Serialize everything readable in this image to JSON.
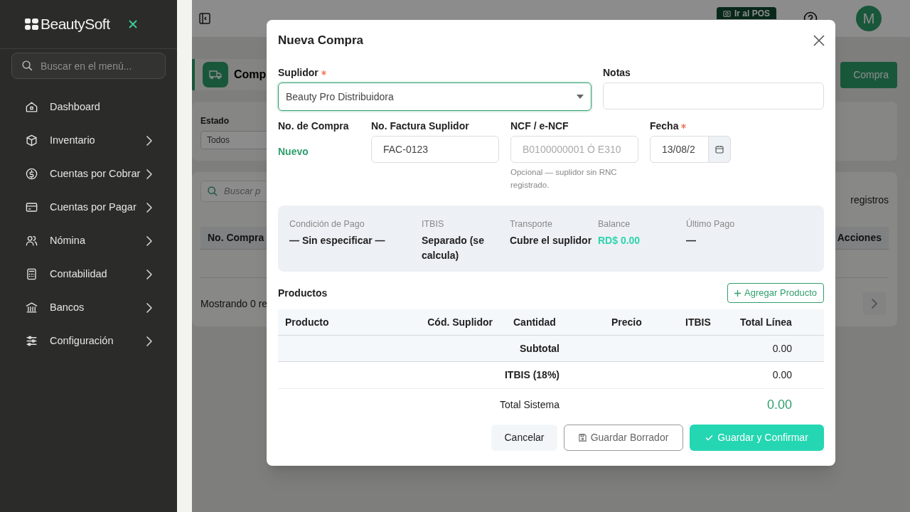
{
  "sidebar": {
    "brand": "BeautySoft",
    "search_placeholder": "Buscar en el menú...",
    "items": [
      {
        "label": "Dashboard",
        "has_submenu": false
      },
      {
        "label": "Inventario",
        "has_submenu": true
      },
      {
        "label": "Cuentas por Cobrar",
        "has_submenu": true
      },
      {
        "label": "Cuentas por Pagar",
        "has_submenu": true
      },
      {
        "label": "Nómina",
        "has_submenu": true
      },
      {
        "label": "Contabilidad",
        "has_submenu": true
      },
      {
        "label": "Bancos",
        "has_submenu": true
      },
      {
        "label": "Configuración",
        "has_submenu": true
      }
    ]
  },
  "header": {
    "pos_button": "Ir al POS",
    "avatar": "M"
  },
  "page": {
    "title": "Comp",
    "new_button": "Compra",
    "filter_label": "Estado",
    "filter_value": "Todos",
    "search_placeholder": "Buscar p",
    "records_label": "registros",
    "columns": [
      "No. Compra",
      "Acciones"
    ],
    "footer": "Mostrando 0 re"
  },
  "modal": {
    "title": "Nueva Compra",
    "supplier": {
      "label": "Suplidor",
      "required": true,
      "value": "Beauty Pro Distribuidora"
    },
    "notes": {
      "label": "Notas",
      "required": false
    },
    "purchase_no": {
      "label": "No. de Compra",
      "value": "Nuevo"
    },
    "invoice": {
      "label": "No. Factura Suplidor",
      "value": "FAC-0123"
    },
    "ncf": {
      "label": "NCF / e-NCF",
      "placeholder": "B0100000001 Ó E310",
      "hint": "Opcional — suplidor sin RNC registrado."
    },
    "date": {
      "label": "Fecha",
      "required": true,
      "value": "13/08/2"
    },
    "summary": [
      {
        "label": "Condición de Pago",
        "value": "— Sin especificar —",
        "kind": "text"
      },
      {
        "label": "ITBIS",
        "value": "Separado (se calcula)",
        "kind": "text"
      },
      {
        "label": "Transporte",
        "value": "Cubre el suplidor",
        "kind": "text"
      },
      {
        "label": "Balance",
        "value": "RD$ 0.00",
        "kind": "amount"
      },
      {
        "label": "Último Pago",
        "value": "—",
        "kind": "text"
      }
    ],
    "products_title": "Productos",
    "add_button": "Agregar Producto",
    "columns": [
      "Producto",
      "Cód. Suplidor",
      "Cantidad",
      "Precio",
      "ITBIS",
      "Total Línea"
    ],
    "totals": [
      {
        "label": "Subtotal",
        "value": "0.00",
        "kind": "subtotal"
      },
      {
        "label": "ITBIS (18%)",
        "value": "0.00",
        "kind": "tax"
      },
      {
        "label": "Total Sistema",
        "value": "0.00",
        "kind": "grand"
      }
    ],
    "buttons": [
      {
        "label": "Cancelar",
        "kind": "cancel"
      },
      {
        "label": "Guardar Borrador",
        "kind": "draft"
      },
      {
        "label": "Guardar y Confirmar",
        "kind": "confirm"
      }
    ]
  }
}
